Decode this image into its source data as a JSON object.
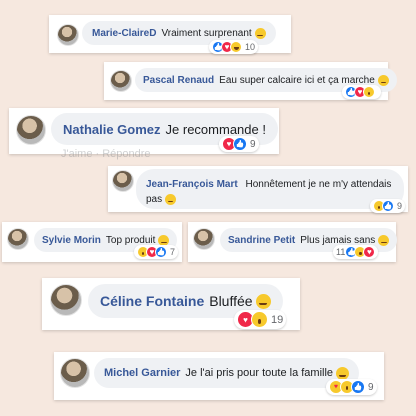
{
  "comments": [
    {
      "name": "Marie-ClaireD",
      "text": "Vraiment surprenant",
      "reactions": [
        "like",
        "love",
        "haha"
      ],
      "count": "10",
      "emoji": "surprised-face"
    },
    {
      "name": "Pascal Renaud",
      "text": "Eau super calcaire ici et ça marche",
      "reactions": [
        "like",
        "love",
        "wow"
      ],
      "count": "",
      "emoji": "ok-hand"
    },
    {
      "name": "Nathalie Gomez",
      "text": "Je recommande !",
      "reactions": [
        "love",
        "like"
      ],
      "count": "9",
      "emoji": ""
    },
    {
      "name": "Jean-François Mart",
      "text": "Honnêtement je ne m'y attendais pas",
      "reactions": [
        "wow",
        "like"
      ],
      "count": "9",
      "emoji": "grinning-face"
    },
    {
      "name": "Sylvie Morin",
      "text": "Top produit",
      "reactions": [
        "wow",
        "love",
        "like"
      ],
      "count": "7",
      "emoji": "thumbs-up"
    },
    {
      "name": "Sandrine Petit",
      "text": "Plus jamais sans",
      "reactions": [
        "like",
        "wow",
        "love"
      ],
      "count": "11",
      "emoji": "grinning-face"
    },
    {
      "name": "Céline Fontaine",
      "text": "Bluffée",
      "reactions": [
        "love",
        "wow"
      ],
      "count": "19",
      "emoji": "star-struck"
    },
    {
      "name": "Michel Garnier",
      "text": "Je l'ai pris pour toute la famille",
      "reactions": [
        "care",
        "wow",
        "like"
      ],
      "count": "9",
      "emoji": "family-heart"
    }
  ],
  "ghost_text": "J'aime · Répondre"
}
